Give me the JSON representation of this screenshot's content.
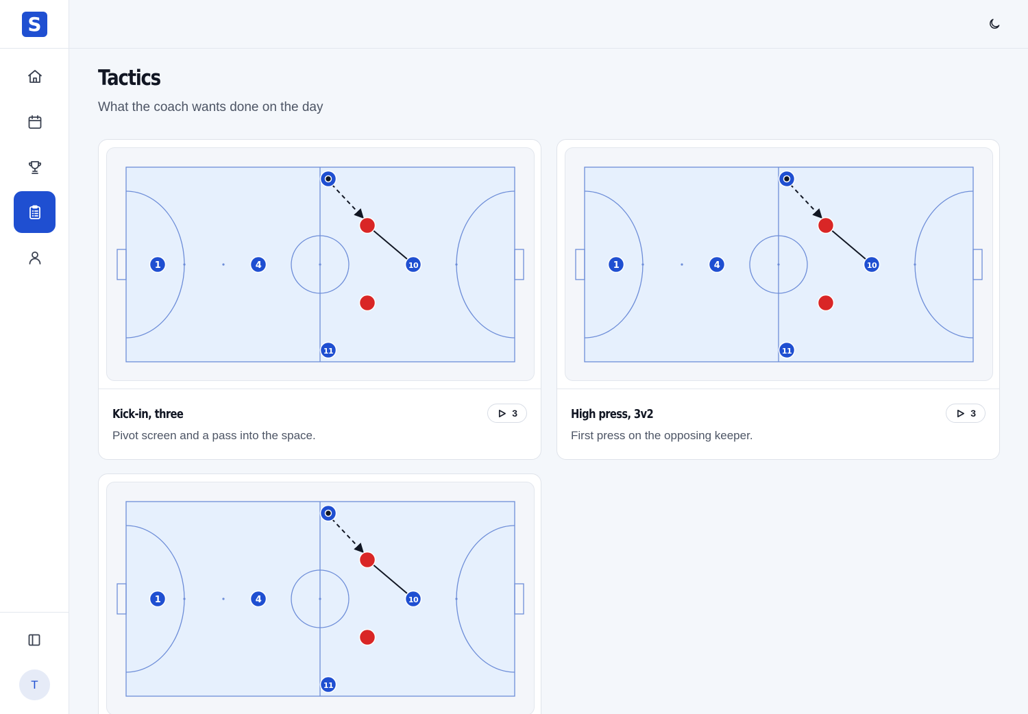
{
  "app": {
    "logo_letter": "S",
    "brand_color": "#1f4fd1"
  },
  "sidebar": {
    "items": [
      {
        "name": "home",
        "icon": "home-icon",
        "active": false
      },
      {
        "name": "calendar",
        "icon": "calendar-icon",
        "active": false
      },
      {
        "name": "trophy",
        "icon": "trophy-icon",
        "active": false
      },
      {
        "name": "tactics",
        "icon": "clipboard-icon",
        "active": true
      },
      {
        "name": "profile",
        "icon": "user-icon",
        "active": false
      }
    ],
    "collapse_icon": "sidebar-toggle-icon",
    "avatar_initial": "T"
  },
  "topbar": {
    "theme_icon": "moon-icon"
  },
  "page": {
    "title": "Tactics",
    "subtitle": "What the coach wants done on the day"
  },
  "tactics": [
    {
      "title": "Kick-in, three",
      "description": "Pivot screen and a pass into the space.",
      "play_count": "3",
      "players": [
        "1",
        "4",
        "10",
        "11"
      ]
    },
    {
      "title": "High press, 3v2",
      "description": "First press on the opposing keeper.",
      "play_count": "3",
      "players": [
        "1",
        "4",
        "10",
        "11"
      ]
    },
    {
      "title": "",
      "description": "",
      "play_count": "",
      "players": [
        "1",
        "4",
        "10",
        "11"
      ]
    }
  ],
  "colors": {
    "pitch_fill": "#e6f0fd",
    "pitch_line": "#6d8dd8",
    "player": "#1f4fd1",
    "opponent": "#d92626"
  }
}
